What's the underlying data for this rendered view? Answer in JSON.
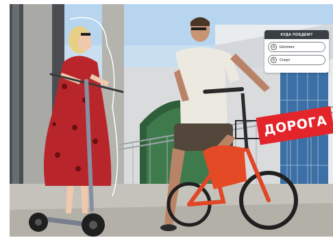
{
  "quiz": {
    "title": "КУДА ПОЕДЕМ?",
    "options": [
      {
        "letter": "А",
        "label": "Шоппинг"
      },
      {
        "letter": "Б",
        "label": "Спорт"
      }
    ]
  },
  "badge": {
    "text": "ДОРОГА"
  },
  "colors": {
    "accent_red": "#e3252b",
    "quiz_header": "#3a3f46"
  }
}
